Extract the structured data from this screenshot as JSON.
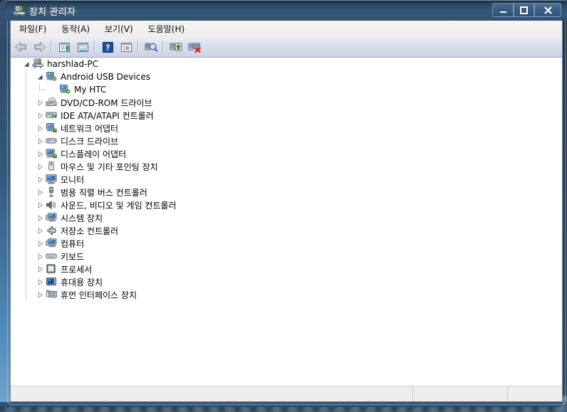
{
  "window": {
    "title": "장치 관리자",
    "icon": "device-manager-icon",
    "buttons": {
      "minimize": "최소화",
      "maximize": "최대화",
      "close": "닫기"
    }
  },
  "menu": [
    {
      "label": "파일(F)",
      "name": "menu-file"
    },
    {
      "label": "동작(A)",
      "name": "menu-action"
    },
    {
      "label": "보기(V)",
      "name": "menu-view"
    },
    {
      "label": "도움말(H)",
      "name": "menu-help"
    }
  ],
  "toolbar": [
    {
      "name": "back-button",
      "icon": "arrow-left-icon",
      "type": "button"
    },
    {
      "name": "forward-button",
      "icon": "arrow-right-icon",
      "type": "button"
    },
    {
      "name": "toolbar-separator-1",
      "icon": "separator",
      "type": "separator"
    },
    {
      "name": "show-hide-console-tree-button",
      "icon": "console-tree-icon",
      "type": "button"
    },
    {
      "name": "properties-button",
      "icon": "properties-icon",
      "type": "button"
    },
    {
      "name": "toolbar-separator-2",
      "icon": "separator",
      "type": "separator"
    },
    {
      "name": "help-button",
      "icon": "help-question-icon",
      "type": "button"
    },
    {
      "name": "show-list-button",
      "icon": "list-view-icon",
      "type": "button"
    },
    {
      "name": "toolbar-separator-3",
      "icon": "separator",
      "type": "separator"
    },
    {
      "name": "scan-for-hardware-changes-button",
      "icon": "scan-hardware-icon",
      "type": "button"
    },
    {
      "name": "toolbar-separator-4",
      "icon": "separator",
      "type": "separator"
    },
    {
      "name": "update-driver-button",
      "icon": "update-driver-icon",
      "type": "button"
    },
    {
      "name": "uninstall-device-button",
      "icon": "uninstall-device-icon",
      "type": "button"
    }
  ],
  "tree": [
    {
      "label": "harshlad-PC",
      "level": 0,
      "state": "expanded",
      "icon": "computer-icon"
    },
    {
      "label": "Android USB Devices",
      "level": 1,
      "state": "expanded",
      "icon": "network-device-icon"
    },
    {
      "label": "My HTC",
      "level": 2,
      "state": "leaf",
      "icon": "network-device-icon"
    },
    {
      "label": "DVD/CD-ROM 드라이브",
      "level": 1,
      "state": "collapsed",
      "icon": "dvd-drive-icon"
    },
    {
      "label": "IDE ATA/ATAPI 컨트롤러",
      "level": 1,
      "state": "collapsed",
      "icon": "ide-controller-icon"
    },
    {
      "label": "네트워크 어댑터",
      "level": 1,
      "state": "collapsed",
      "icon": "network-adapter-icon"
    },
    {
      "label": "디스크 드라이브",
      "level": 1,
      "state": "collapsed",
      "icon": "disk-drive-icon"
    },
    {
      "label": "디스플레이 어댑터",
      "level": 1,
      "state": "collapsed",
      "icon": "display-adapter-icon"
    },
    {
      "label": "마우스 및 기타 포인팅 장치",
      "level": 1,
      "state": "collapsed",
      "icon": "mouse-icon"
    },
    {
      "label": "모니터",
      "level": 1,
      "state": "collapsed",
      "icon": "monitor-icon"
    },
    {
      "label": "범용 직렬 버스 컨트롤러",
      "level": 1,
      "state": "collapsed",
      "icon": "usb-controller-icon"
    },
    {
      "label": "사운드, 비디오 및 게임 컨트롤러",
      "level": 1,
      "state": "collapsed",
      "icon": "speaker-icon"
    },
    {
      "label": "시스템 장치",
      "level": 1,
      "state": "collapsed",
      "icon": "system-device-icon"
    },
    {
      "label": "저장소 컨트롤러",
      "level": 1,
      "state": "collapsed",
      "icon": "storage-controller-icon"
    },
    {
      "label": "컴퓨터",
      "level": 1,
      "state": "collapsed",
      "icon": "system-device-icon"
    },
    {
      "label": "키보드",
      "level": 1,
      "state": "collapsed",
      "icon": "keyboard-icon"
    },
    {
      "label": "프로세서",
      "level": 1,
      "state": "collapsed",
      "icon": "processor-icon"
    },
    {
      "label": "휴대용 장치",
      "level": 1,
      "state": "collapsed",
      "icon": "portable-device-icon"
    },
    {
      "label": "휴먼 인터페이스 장치",
      "level": 1,
      "state": "collapsed",
      "icon": "hid-device-icon"
    }
  ],
  "statusbar": {
    "main": "",
    "pane2": "",
    "pane3": ""
  },
  "colors": {
    "titlebar": "#31526f",
    "toolbar": "#d4d8ea",
    "tree_background": "#ffffff",
    "status_background": "#f0eeec",
    "accent_blue": "#2f6bb5",
    "accent_green": "#4d9b22",
    "accent_red": "#cc2222"
  }
}
